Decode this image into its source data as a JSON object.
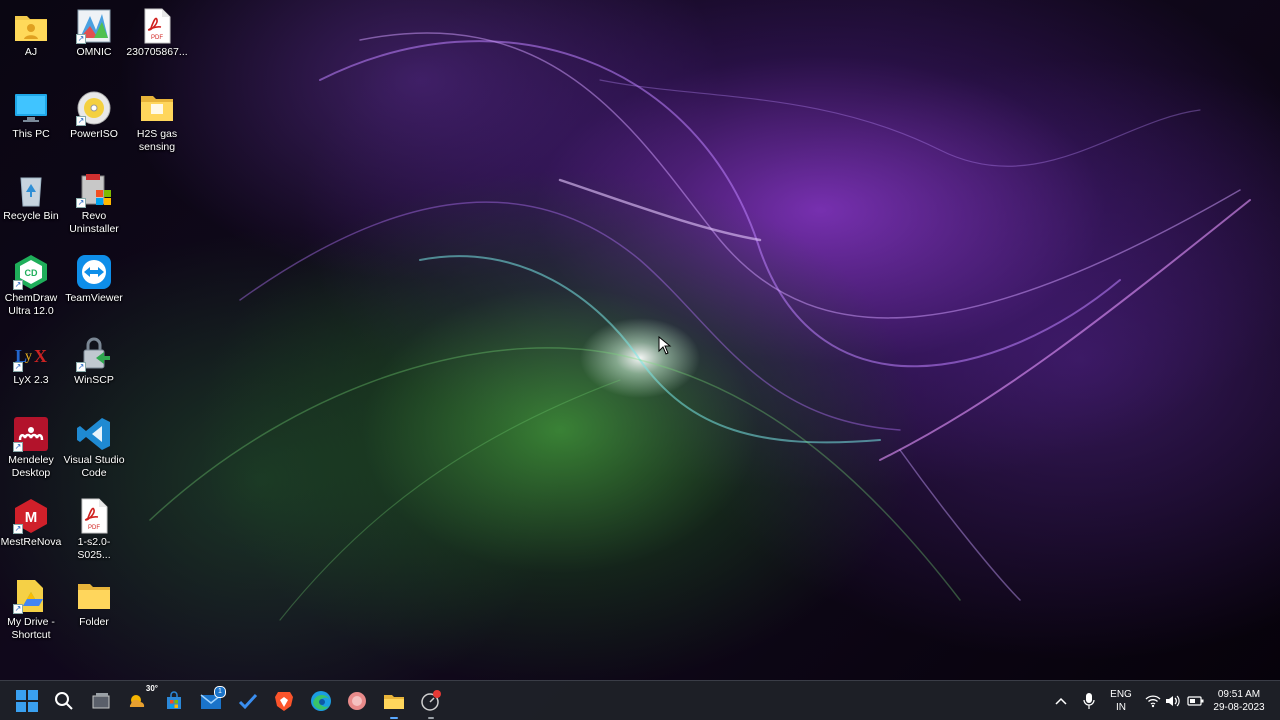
{
  "desktop_icons": [
    {
      "label": "AJ",
      "icon": "user-folder-icon"
    },
    {
      "label": "OMNIC",
      "icon": "omnic-app-icon"
    },
    {
      "label": "230705867...",
      "icon": "pdf-file-icon"
    },
    {
      "label": "This PC",
      "icon": "monitor-icon"
    },
    {
      "label": "PowerISO",
      "icon": "disc-icon"
    },
    {
      "label": "H2S gas sensing",
      "icon": "folder-icon"
    },
    {
      "label": "Recycle Bin",
      "icon": "recycle-bin-icon"
    },
    {
      "label": "Revo Uninstaller",
      "icon": "revo-uninstaller-icon"
    },
    {
      "label": "ChemDraw Ultra 12.0",
      "icon": "chemdraw-icon"
    },
    {
      "label": "TeamViewer",
      "icon": "teamviewer-icon"
    },
    {
      "label": "LyX 2.3",
      "icon": "lyx-icon"
    },
    {
      "label": "WinSCP",
      "icon": "winscp-icon"
    },
    {
      "label": "Mendeley Desktop",
      "icon": "mendeley-icon"
    },
    {
      "label": "Visual Studio Code",
      "icon": "vscode-icon"
    },
    {
      "label": "MestReNova",
      "icon": "mestrenova-icon"
    },
    {
      "label": "1-s2.0-S025...",
      "icon": "pdf-file-icon"
    },
    {
      "label": "My Drive - Shortcut",
      "icon": "google-drive-icon"
    },
    {
      "label": "Folder",
      "icon": "folder-icon"
    }
  ],
  "taskbar": {
    "weather_temp": "30°",
    "mail_badge": "1",
    "items": [
      {
        "name": "start-button-icon"
      },
      {
        "name": "search-icon"
      },
      {
        "name": "task-view-icon"
      },
      {
        "name": "weather-widget-icon"
      },
      {
        "name": "microsoft-store-icon"
      },
      {
        "name": "mail-icon"
      },
      {
        "name": "todo-icon"
      },
      {
        "name": "brave-browser-icon"
      },
      {
        "name": "edge-browser-icon"
      },
      {
        "name": "app-icon"
      },
      {
        "name": "file-explorer-icon"
      },
      {
        "name": "screen-recorder-icon"
      }
    ]
  },
  "tray": {
    "language": "ENG",
    "region": "IN",
    "time": "09:51 AM",
    "date": "29-08-2023"
  },
  "colors": {
    "taskbar_bg": "#1e2028",
    "accent": "#0078d4"
  }
}
